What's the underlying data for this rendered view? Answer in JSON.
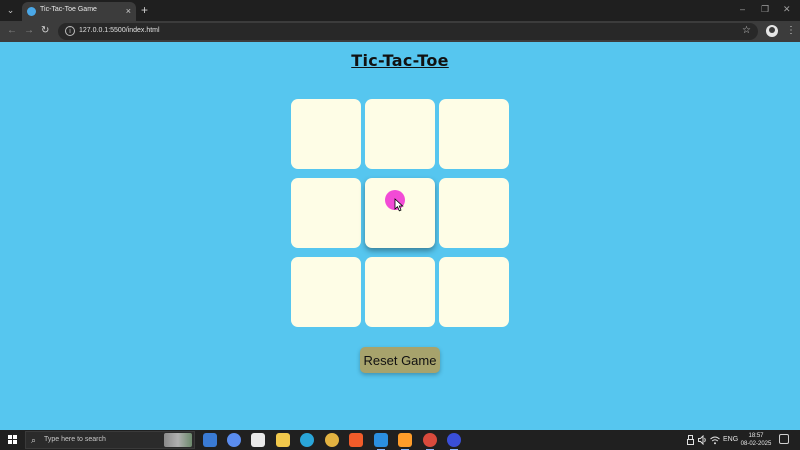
{
  "browser": {
    "tab_title": "Tic-Tac-Toe Game",
    "tab_close": "×",
    "new_tab": "+",
    "url": "127.0.0.1:5500/index.html",
    "window_controls": {
      "minimize": "–",
      "maximize": "❐",
      "close": "✕"
    },
    "icons": {
      "back": "←",
      "forward": "→",
      "reload": "↻",
      "site_info": "i",
      "bookmark": "☆",
      "menu": "⋮",
      "tab_search": "⌄"
    }
  },
  "page": {
    "title": "Tic-Tac-Toe",
    "board": {
      "cells": [
        "",
        "",
        "",
        "",
        "",
        "",
        "",
        "",
        ""
      ],
      "hovered_cell": 4
    },
    "reset_label": "Reset Game"
  },
  "taskbar": {
    "search_placeholder": "Type here to search",
    "search_icon": "⌕",
    "language": "ENG",
    "time": "18:57",
    "date": "08-02-2025",
    "tray_icons": [
      "usb-icon",
      "speaker-icon",
      "wifi-icon"
    ],
    "apps": [
      {
        "name": "windows-security-icon",
        "color": "#3a7bd5"
      },
      {
        "name": "copilot-icon",
        "color": "#5b8def"
      },
      {
        "name": "calendar-icon",
        "color": "#e8e8e8"
      },
      {
        "name": "file-explorer-icon",
        "color": "#f2c94c"
      },
      {
        "name": "edge-icon",
        "color": "#2aa6d9"
      },
      {
        "name": "chrome-icon",
        "color": "#e3b341"
      },
      {
        "name": "brave-icon",
        "color": "#f25c2a"
      },
      {
        "name": "vscode-icon",
        "color": "#2b8fe0"
      },
      {
        "name": "sublime-text-icon",
        "color": "#ff9d2a"
      },
      {
        "name": "chrome-profile-icon",
        "color": "#d94a3c"
      },
      {
        "name": "screen-recorder-icon",
        "color": "#3a4fd9"
      }
    ]
  },
  "colors": {
    "page_bg": "#56c6ef",
    "cell_bg": "#fefde6",
    "button_bg": "#a7a36c",
    "cursor_highlight": "#f24bd6"
  }
}
